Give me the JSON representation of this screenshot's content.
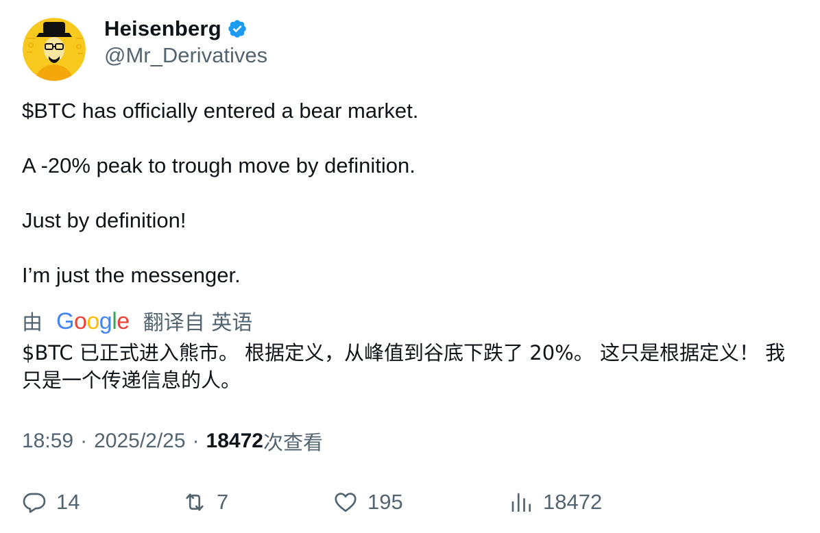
{
  "author": {
    "display_name": "Heisenberg",
    "handle": "@Mr_Derivatives",
    "verified": true,
    "avatar_icon": "heisenberg-avatar",
    "verified_color": "#1d9bf0"
  },
  "tweet": {
    "paragraphs": [
      "$BTC has officially entered a bear market.",
      "A -20% peak to trough move by definition.",
      "Just by definition!",
      "I’m just the messenger."
    ]
  },
  "translation": {
    "prefix": "由",
    "provider": "Google",
    "suffix": "翻译自 英语",
    "text": "$BTC 已正式进入熊市。 根据定义，从峰值到谷底下跌了 20%。 这只是根据定义！ 我只是一个传递信息的人。"
  },
  "meta": {
    "time": "18:59",
    "date": "2025/2/25",
    "separator": "·",
    "views_count": "18472",
    "views_label": "次查看"
  },
  "actions": {
    "replies": "14",
    "retweets": "7",
    "likes": "195",
    "views": "18472"
  },
  "colors": {
    "text_primary": "#0f1419",
    "text_secondary": "#536471",
    "google_blue": "#4285F4",
    "google_red": "#EA4335",
    "google_yellow": "#FBBC05",
    "google_green": "#34A853"
  }
}
